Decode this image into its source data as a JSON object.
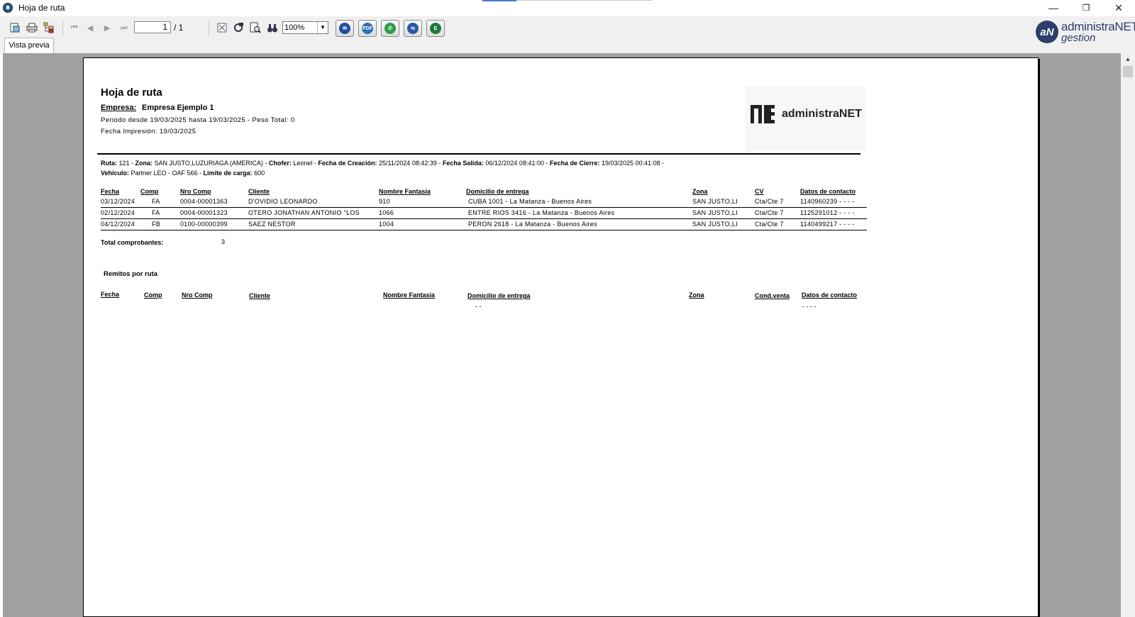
{
  "window": {
    "title": "Hoja de ruta",
    "controls": [
      "—",
      "❐",
      "✕"
    ]
  },
  "toolbar": {
    "page_current": "1",
    "page_total": "/ 1",
    "zoom": "100%",
    "share_buttons": [
      {
        "name": "email-icon",
        "color": "#1f4e9c",
        "glyph": "✉"
      },
      {
        "name": "pdf-icon",
        "color": "#2f6fb6",
        "glyph": "PDF"
      },
      {
        "name": "whatsapp-icon",
        "color": "#2a9d44",
        "glyph": "✆"
      },
      {
        "name": "export-icon",
        "color": "#2b58a8",
        "glyph": "⇆"
      },
      {
        "name": "excel-icon",
        "color": "#1e7a3c",
        "glyph": "E"
      }
    ]
  },
  "brand": {
    "line1": "administraNET",
    "line2": "gestion",
    "logo": "aN"
  },
  "tabs": {
    "preview": "Vista previa"
  },
  "report": {
    "title": "Hoja de ruta",
    "company_label": "Empresa:",
    "company": "Empresa Ejemplo 1",
    "period": "Periodo desde  19/03/2025 hasta 19/03/2025 - Peso Total: 0",
    "print_date": "Fecha Impresión: 19/03/2025",
    "logo_text": "administraNET",
    "route_line1": [
      {
        "t": "Ruta:",
        "b": true
      },
      {
        "t": " 121 - ",
        "b": false
      },
      {
        "t": "Zona:",
        "b": true
      },
      {
        "t": " SAN JUSTO,LUZURIAGA (AMERICA) - ",
        "b": false
      },
      {
        "t": "Chofer:",
        "b": true
      },
      {
        "t": " Leonel - ",
        "b": false
      },
      {
        "t": "Fecha de Creación:",
        "b": true
      },
      {
        "t": " 25/11/2024  08:42:39 - ",
        "b": false
      },
      {
        "t": "Fecha Salida:",
        "b": true
      },
      {
        "t": " 06/12/2024  08:41:00 - ",
        "b": false
      },
      {
        "t": "Fecha de Cierre:",
        "b": true
      },
      {
        "t": " 19/03/2025  00:41:08 -",
        "b": false
      }
    ],
    "route_line2": [
      {
        "t": "Vehiculo:",
        "b": true
      },
      {
        "t": " Partner LEO - OAF 566 - ",
        "b": false
      },
      {
        "t": "Limite de carga:",
        "b": true
      },
      {
        "t": " 600",
        "b": false
      }
    ],
    "table1": {
      "headers": [
        "Fecha",
        "Comp",
        "Nro Comp",
        "Cliente",
        "Nombre Fantasia",
        "Domicilio de entrega",
        "Zona",
        "CV",
        "Datos de contacto"
      ],
      "rows": [
        [
          "03/12/2024",
          "FA",
          "0004-00001363",
          "D'OVIDIO LEONARDO",
          "910",
          "CUBA 1001  - La Matanza - Buenos Aires",
          "SAN JUSTO,LI",
          "Cta/Cte 7",
          "1140960239 - - - -"
        ],
        [
          "02/12/2024",
          "FA",
          "0004-00001323",
          "OTERO JONATHAN ANTONIO \"LOS",
          "1066",
          "ENTRE RIOS 3416  - La Matanza - Buenos Aires",
          "SAN JUSTO,LI",
          "Cta/Cte 7",
          "1125291012 - - - -"
        ],
        [
          "04/12/2024",
          "FB",
          "0100-00000399",
          "SAEZ NESTOR",
          "1004",
          "PERON 2618  - La Matanza - Buenos Aires",
          "SAN JUSTO,LI",
          "Cta/Cte 7",
          "1140499217 - - - -"
        ]
      ]
    },
    "total_label": "Total comprobantes:",
    "total_value": "3",
    "remitos_title": "Remitos por ruta",
    "table2": {
      "headers": [
        "Fecha",
        "Comp",
        "Nro Comp",
        "Cliente",
        "Nombre Fantasia",
        "Domicilio de entrega",
        "Zona",
        "Cond.venta",
        "Datos de contacto"
      ],
      "row": {
        "domicilio": "- -",
        "contacto": "- - - -"
      }
    }
  }
}
